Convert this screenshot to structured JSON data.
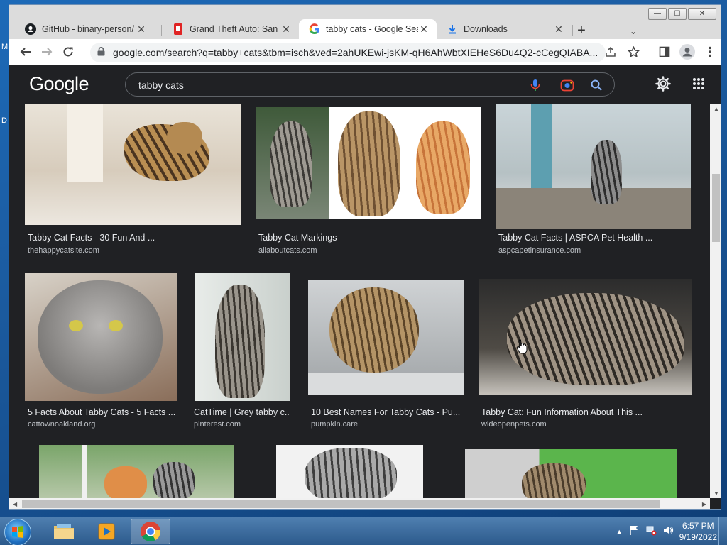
{
  "desktop": {
    "icon_labels": [
      "M",
      "D"
    ]
  },
  "window": {
    "controls": {
      "minimize": "—",
      "maximize": "☐",
      "close": "✕"
    }
  },
  "tabs": [
    {
      "title": "GitHub - binary-person/",
      "icon": "github-icon",
      "active": false
    },
    {
      "title": "Grand Theft Auto: San A",
      "icon": "bookmark-red-icon",
      "active": false
    },
    {
      "title": "tabby cats - Google Sea",
      "icon": "google-g-icon",
      "active": true
    },
    {
      "title": "Downloads",
      "icon": "download-icon",
      "active": false
    }
  ],
  "tabstrip": {
    "new_tab": "+",
    "tab_search": "⌄"
  },
  "toolbar": {
    "url": "google.com/search?q=tabby+cats&tbm=isch&ved=2ahUKEwi-jsKM-qH6AhWbtXIEHeS6Du4Q2-cCegQIABA..."
  },
  "google": {
    "logo": "Google",
    "search_query": "tabby cats"
  },
  "colors": {
    "accent_blue": "#8ab4f8",
    "page_bg": "#202124",
    "text": "#e8eaed",
    "muted": "#bdc1c6"
  },
  "results": [
    {
      "caption": "Tabby Cat Facts - 30 Fun And ...",
      "source": "thehappycatsite.com"
    },
    {
      "caption": "Tabby Cat Markings",
      "source": "allaboutcats.com"
    },
    {
      "caption": "Tabby Cat Facts | ASPCA Pet Health ...",
      "source": "aspcapetinsurance.com"
    },
    {
      "caption": "5 Facts About Tabby Cats - 5 Facts ...",
      "source": "cattownoakland.org"
    },
    {
      "caption": "CatTime | Grey tabby c...",
      "source": "pinterest.com"
    },
    {
      "caption": "10 Best Names For Tabby Cats - Pu...",
      "source": "pumpkin.care"
    },
    {
      "caption": "Tabby Cat: Fun Information About This ...",
      "source": "wideopenpets.com"
    }
  ],
  "taskbar": {
    "time": "6:57 PM",
    "date": "9/19/2022",
    "tray_expand": "▲"
  }
}
